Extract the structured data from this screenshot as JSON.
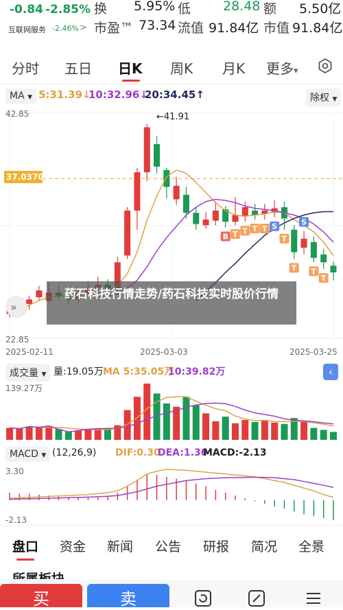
{
  "header": {
    "change_value": "-0.84",
    "change_pct": "-2.85%",
    "turnover_label": "换",
    "turnover_value": "5.95%",
    "low_label": "低",
    "low_value": "28.48",
    "amount_label": "额",
    "amount_value": "5.50亿",
    "sector_name": "互联网服务",
    "sector_change": "-2.46%",
    "sector_chevron": ">",
    "pe_label": "市盈™",
    "pe_value": "73.34",
    "float_cap_label": "流值",
    "float_cap_value": "91.84亿",
    "market_cap_label": "市值",
    "market_cap_value": "91.84亿"
  },
  "tabs": [
    {
      "label": "分时",
      "active": false
    },
    {
      "label": "五日",
      "active": false
    },
    {
      "label": "日K",
      "active": true
    },
    {
      "label": "周K",
      "active": false
    },
    {
      "label": "月K",
      "active": false
    },
    {
      "label": "更多",
      "active": false
    }
  ],
  "tab_more_caret": "▾",
  "settings_icon": "settings-icon",
  "ma_bar": {
    "selector": "MA",
    "ma5": "5:31.39↓",
    "ma10": "10:32.96↓",
    "ma20": "20:34.45↑",
    "adjust": "除权"
  },
  "colors": {
    "up": "#e23b3b",
    "down": "#1a9a55",
    "ma5": "#e0a045",
    "ma10": "#9b3fc9",
    "ma20": "#1e2a5a",
    "ref_line": "#f0b030",
    "t_marker": "#f4a35c",
    "s_marker": "#5b8de8",
    "b_marker": "#e86a5c"
  },
  "main_chart": {
    "price_max_label": "42.85",
    "price_min_label": "22.85",
    "ref_price": "37.0370",
    "high_annotation": "←41.91",
    "expand_icon": "expand-left-icon",
    "dates": [
      "2025-02-11",
      "2025-03-03",
      "2025-03-25"
    ]
  },
  "chart_data": {
    "type": "candlestick",
    "ylim": [
      22.85,
      42.85
    ],
    "candles": [
      {
        "o": 25.0,
        "c": 25.3,
        "h": 25.6,
        "l": 24.7
      },
      {
        "o": 25.1,
        "c": 25.8,
        "h": 26.2,
        "l": 24.9
      },
      {
        "o": 25.9,
        "c": 26.3,
        "h": 26.6,
        "l": 25.4
      },
      {
        "o": 26.5,
        "c": 27.1,
        "h": 27.5,
        "l": 26.2
      },
      {
        "o": 26.2,
        "c": 26.9,
        "h": 27.8,
        "l": 26.0
      },
      {
        "o": 26.9,
        "c": 26.6,
        "h": 27.5,
        "l": 26.2
      },
      {
        "o": 26.6,
        "c": 26.3,
        "h": 27.0,
        "l": 25.9
      },
      {
        "o": 26.3,
        "c": 26.8,
        "h": 27.1,
        "l": 26.0
      },
      {
        "o": 26.8,
        "c": 27.3,
        "h": 27.9,
        "l": 26.5
      },
      {
        "o": 27.3,
        "c": 27.6,
        "h": 28.3,
        "l": 27.0
      },
      {
        "o": 27.6,
        "c": 27.3,
        "h": 28.1,
        "l": 26.9
      },
      {
        "o": 27.3,
        "c": 29.6,
        "h": 30.1,
        "l": 27.0
      },
      {
        "o": 30.2,
        "c": 34.2,
        "h": 34.5,
        "l": 29.9
      },
      {
        "o": 34.2,
        "c": 37.6,
        "h": 38.0,
        "l": 32.5
      },
      {
        "o": 37.6,
        "c": 41.6,
        "h": 41.91,
        "l": 36.8
      },
      {
        "o": 40.1,
        "c": 38.1,
        "h": 40.8,
        "l": 37.5
      },
      {
        "o": 37.8,
        "c": 36.3,
        "h": 38.0,
        "l": 35.3
      },
      {
        "o": 35.2,
        "c": 36.4,
        "h": 37.2,
        "l": 34.7
      },
      {
        "o": 35.6,
        "c": 34.0,
        "h": 36.3,
        "l": 33.5
      },
      {
        "o": 34.0,
        "c": 33.0,
        "h": 34.5,
        "l": 32.5
      },
      {
        "o": 32.9,
        "c": 33.4,
        "h": 34.1,
        "l": 32.6
      },
      {
        "o": 33.3,
        "c": 34.2,
        "h": 35.0,
        "l": 32.9
      },
      {
        "o": 34.3,
        "c": 33.2,
        "h": 34.6,
        "l": 32.7
      },
      {
        "o": 33.2,
        "c": 33.8,
        "h": 35.4,
        "l": 32.9
      },
      {
        "o": 33.7,
        "c": 34.5,
        "h": 35.0,
        "l": 33.2
      },
      {
        "o": 34.2,
        "c": 33.8,
        "h": 34.8,
        "l": 33.4
      },
      {
        "o": 33.9,
        "c": 34.2,
        "h": 34.8,
        "l": 33.4
      },
      {
        "o": 34.0,
        "c": 34.4,
        "h": 35.1,
        "l": 33.6
      },
      {
        "o": 34.5,
        "c": 33.5,
        "h": 35.0,
        "l": 32.5
      },
      {
        "o": 32.5,
        "c": 30.5,
        "h": 32.9,
        "l": 29.9
      },
      {
        "o": 30.9,
        "c": 31.7,
        "h": 32.4,
        "l": 30.3
      },
      {
        "o": 31.4,
        "c": 30.0,
        "h": 31.9,
        "l": 29.6
      },
      {
        "o": 30.3,
        "c": 29.6,
        "h": 30.8,
        "l": 29.0
      },
      {
        "o": 29.3,
        "c": 28.7,
        "h": 29.7,
        "l": 28.0
      }
    ],
    "ma5": [
      25.0,
      25.4,
      25.8,
      26.2,
      26.5,
      26.6,
      26.6,
      26.5,
      26.6,
      26.9,
      27.1,
      27.5,
      28.6,
      30.5,
      33.3,
      35.5,
      37.2,
      37.8,
      37.5,
      36.7,
      35.8,
      34.9,
      34.2,
      33.8,
      33.7,
      33.8,
      33.9,
      34.1,
      34.0,
      33.4,
      32.9,
      32.3,
      31.4,
      30.2
    ],
    "ma10": [
      null,
      null,
      null,
      null,
      null,
      null,
      null,
      null,
      null,
      26.4,
      26.6,
      26.8,
      27.3,
      28.0,
      29.2,
      30.6,
      31.8,
      32.8,
      33.8,
      34.5,
      35.0,
      35.2,
      35.1,
      34.9,
      34.6,
      34.4,
      34.3,
      34.2,
      34.0,
      33.8,
      33.5,
      33.0,
      32.3,
      31.4
    ],
    "ma20": [
      null,
      null,
      null,
      null,
      null,
      null,
      null,
      null,
      null,
      null,
      null,
      null,
      null,
      null,
      null,
      null,
      null,
      null,
      null,
      26.2,
      27.0,
      27.8,
      28.7,
      29.5,
      30.4,
      31.2,
      32.0,
      32.6,
      33.1,
      33.5,
      33.8,
      34.0,
      34.1,
      34.1
    ],
    "markers": [
      {
        "i": 22,
        "t": "B",
        "place": "below"
      },
      {
        "i": 23,
        "t": "T",
        "place": "below"
      },
      {
        "i": 24,
        "t": "T",
        "place": "below"
      },
      {
        "i": 25,
        "t": "T",
        "place": "below"
      },
      {
        "i": 26,
        "t": "T",
        "place": "below"
      },
      {
        "i": 27,
        "t": "S",
        "place": "below"
      },
      {
        "i": 28,
        "t": "T",
        "place": "below"
      },
      {
        "i": 29,
        "t": "T",
        "place": "below"
      },
      {
        "i": 30,
        "t": "S",
        "place": "above"
      },
      {
        "i": 31,
        "t": "T",
        "place": "below"
      },
      {
        "i": 32,
        "t": "T",
        "place": "below"
      }
    ]
  },
  "volume": {
    "selector": "成交量",
    "amount": "量:19.05万",
    "ma5": "MA 5:35.05万",
    "ma10": "10:39.82万",
    "max_label": "139.27万",
    "collapse_icon": "chevron-left-icon",
    "bars": [
      18,
      17,
      20,
      19,
      21,
      16,
      12,
      14,
      16,
      17,
      18,
      22,
      45,
      65,
      85,
      70,
      55,
      50,
      65,
      52,
      40,
      28,
      35,
      25,
      30,
      27,
      30,
      26,
      24,
      33,
      27,
      18,
      15,
      12
    ]
  },
  "macd": {
    "selector": "MACD",
    "params": "(12,26,9)",
    "dif": "DIF:0.30",
    "dea": "DEA:1.36",
    "macd_value": "MACD:-2.13",
    "max_label": "3.30",
    "min_label": "-2.13",
    "hist": [
      0.8,
      0.7,
      0.7,
      0.6,
      0.5,
      0.4,
      0.3,
      0.3,
      0.3,
      0.4,
      0.4,
      0.8,
      1.5,
      2.2,
      2.8,
      2.7,
      2.5,
      2.3,
      2.1,
      1.8,
      1.5,
      1.1,
      0.8,
      0.5,
      0.2,
      -0.1,
      -0.4,
      -0.7,
      -0.9,
      -1.2,
      -1.5,
      -1.7,
      -1.9,
      -2.13
    ],
    "dif_line": [
      0.2,
      0.25,
      0.3,
      0.35,
      0.4,
      0.45,
      0.5,
      0.55,
      0.6,
      0.7,
      0.8,
      1.0,
      1.5,
      2.1,
      2.8,
      3.1,
      3.3,
      3.25,
      3.2,
      3.1,
      3.0,
      2.9,
      2.8,
      2.7,
      2.6,
      2.5,
      2.3,
      2.1,
      1.9,
      1.6,
      1.3,
      1.0,
      0.6,
      0.3
    ],
    "dea_line": [
      0.1,
      0.12,
      0.15,
      0.18,
      0.21,
      0.24,
      0.27,
      0.3,
      0.33,
      0.37,
      0.42,
      0.5,
      0.7,
      0.9,
      1.2,
      1.5,
      1.7,
      1.9,
      2.1,
      2.2,
      2.3,
      2.35,
      2.4,
      2.42,
      2.44,
      2.45,
      2.44,
      2.4,
      2.3,
      2.2,
      2.0,
      1.8,
      1.6,
      1.36
    ]
  },
  "overlay": {
    "text": "药石科技行情走势/药石科技实时股价行情"
  },
  "bottom_nav": [
    "盘口",
    "资金",
    "新闻",
    "公告",
    "研报",
    "简况",
    "全景"
  ],
  "bottom_partial": "所属板块",
  "actions": {
    "buy": "买",
    "sell": "卖"
  }
}
